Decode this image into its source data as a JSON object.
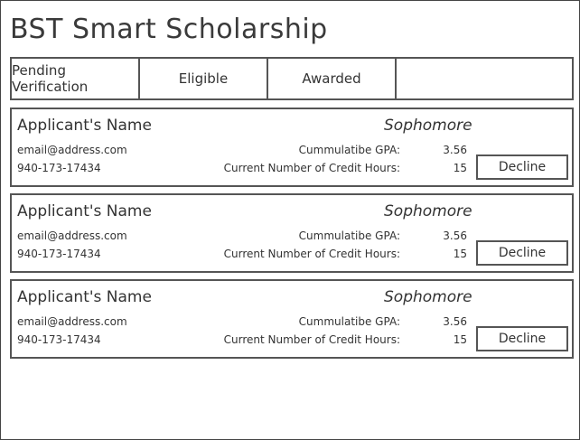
{
  "app": {
    "title": "BST Smart Scholarship"
  },
  "tabs": [
    {
      "label": "Pending Verification"
    },
    {
      "label": "Eligible"
    },
    {
      "label": "Awarded"
    },
    {
      "label": ""
    }
  ],
  "applicants": [
    {
      "name": "Applicant's Name",
      "year": "Sophomore",
      "email": "email@address.com",
      "phone": "940-173-17434",
      "gpa_label": "Cummulatibe GPA:",
      "gpa_value": "3.56",
      "credit_label": "Current Number of Credit Hours:",
      "credit_value": "15",
      "decline_label": "Decline"
    },
    {
      "name": "Applicant's Name",
      "year": "Sophomore",
      "email": "email@address.com",
      "phone": "940-173-17434",
      "gpa_label": "Cummulatibe GPA:",
      "gpa_value": "3.56",
      "credit_label": "Current Number of Credit Hours:",
      "credit_value": "15",
      "decline_label": "Decline"
    },
    {
      "name": "Applicant's Name",
      "year": "Sophomore",
      "email": "email@address.com",
      "phone": "940-173-17434",
      "gpa_label": "Cummulatibe GPA:",
      "gpa_value": "3.56",
      "credit_label": "Current Number of Credit Hours:",
      "credit_value": "15",
      "decline_label": "Decline"
    }
  ]
}
